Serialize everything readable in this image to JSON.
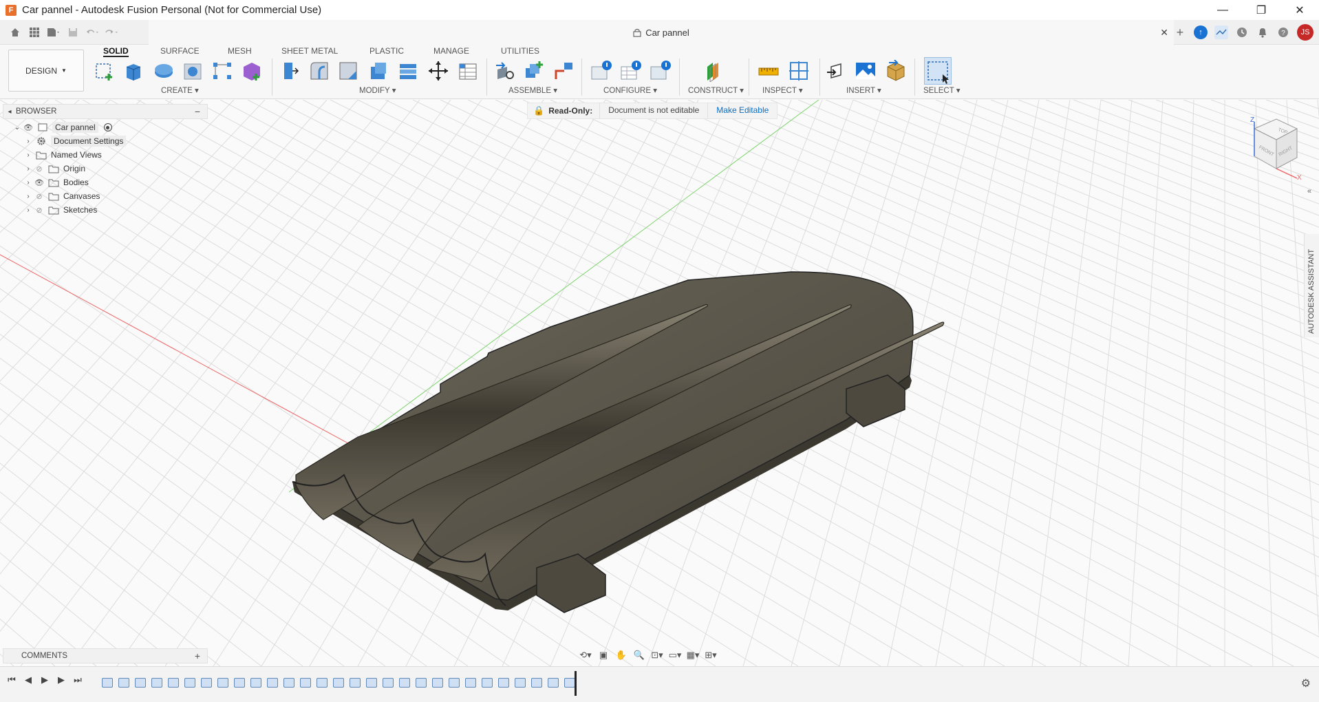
{
  "window": {
    "title": "Car pannel - Autodesk Fusion Personal (Not for Commercial Use)",
    "app_icon": "F",
    "controls": [
      "—",
      "❐",
      "✕"
    ]
  },
  "tabbar": {
    "document_tab": "Car pannel",
    "user_initials": "JS"
  },
  "ribbon": {
    "workspace": "DESIGN",
    "tabs": [
      "SOLID",
      "SURFACE",
      "MESH",
      "SHEET METAL",
      "PLASTIC",
      "MANAGE",
      "UTILITIES"
    ],
    "active_tab": "SOLID",
    "groups": [
      "CREATE",
      "MODIFY",
      "ASSEMBLE",
      "CONFIGURE",
      "CONSTRUCT",
      "INSPECT",
      "INSERT",
      "SELECT"
    ]
  },
  "browser": {
    "title": "BROWSER",
    "root": "Car pannel",
    "items": [
      "Document Settings",
      "Named Views",
      "Origin",
      "Bodies",
      "Canvases",
      "Sketches"
    ]
  },
  "banner": {
    "label": "Read-Only:",
    "message": "Document is not editable",
    "action": "Make Editable"
  },
  "viewcube": {
    "faces": [
      "TOP",
      "FRONT",
      "RIGHT"
    ],
    "axes": [
      "Z",
      "X"
    ]
  },
  "assistant": {
    "label": "AUTODESK ASSISTANT"
  },
  "comments": {
    "title": "COMMENTS"
  },
  "colors": {
    "accent": "#0a6dc2",
    "lock": "#e69200",
    "body_fill": "#5a554a",
    "avatar": "#c62828"
  }
}
